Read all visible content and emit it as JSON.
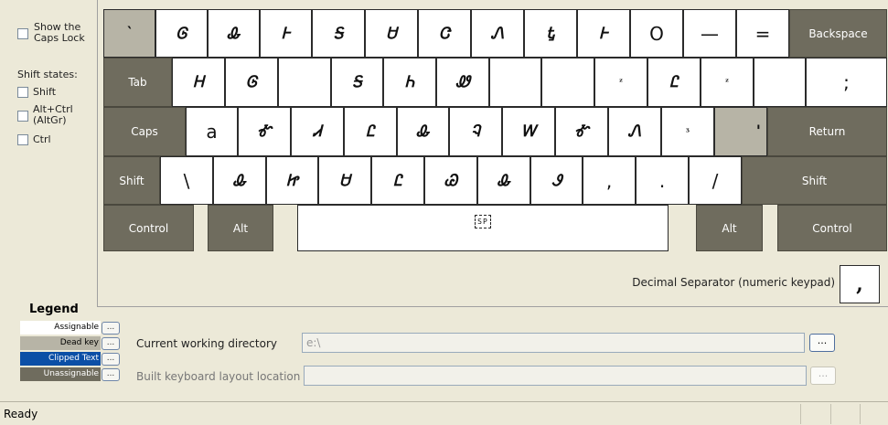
{
  "left_panel": {
    "show_caps_lock": "Show the Caps Lock",
    "show_caps_line1": "Show the",
    "show_caps_line2": "Caps Lock",
    "shift_states_label": "Shift states:",
    "shift": "Shift",
    "altctrl_line1": "Alt+Ctrl",
    "altctrl_line2": "(AltGr)",
    "ctrl": "Ctrl"
  },
  "keys": {
    "row1": [
      "`",
      "Ꮆ",
      "Ꮂ",
      "Ꮀ",
      "Ꭶ",
      "Ꮜ",
      "Ꮳ",
      "Ꮑ",
      "Ꮏ",
      "Ꮀ",
      "O",
      "—",
      "="
    ],
    "backspace": "Backspace",
    "tab": "Tab",
    "row2": [
      "Ꮋ",
      "Ꮆ",
      "",
      "Ꭶ",
      "Ꮒ",
      "Ꮺ",
      "",
      "",
      "ᶻ",
      "Ꮭ",
      "ᶻ",
      "",
      ";"
    ],
    "caps": "Caps",
    "row3": [
      "a",
      "Ꮉ",
      "Ꮧ",
      "Ꮭ",
      "Ꮂ",
      "Ꮈ",
      "Ꮃ",
      "Ꮉ",
      "Ꮑ",
      "ᶾ",
      "'"
    ],
    "return": "Return",
    "shift_left": "Shift",
    "row4": [
      "\\",
      "Ꮂ",
      "Ꮵ",
      "Ꮜ",
      "Ꮭ",
      "Ꮚ",
      "Ꮂ",
      "Ꮽ",
      ",",
      ".",
      "/"
    ],
    "shift_right": "Shift",
    "control_left": "Control",
    "alt_left": "Alt",
    "space": "SP",
    "alt_right": "Alt",
    "control_right": "Control"
  },
  "decimal": {
    "label": "Decimal Separator (numeric keypad)",
    "value": ","
  },
  "legend": {
    "title": "Legend",
    "items": [
      "Assignable",
      "Dead key",
      "Clipped Text",
      "Unassignable"
    ],
    "button": "...",
    "colors": {
      "assignable": "#ffffff",
      "dead_key": "#b7b4a6",
      "clipped_text": "#0b4fa6",
      "unassignable": "#6f6c5e"
    }
  },
  "paths": {
    "cwd_label": "Current working directory",
    "cwd_value": "e:\\",
    "build_label": "Built keyboard layout location",
    "build_value": "",
    "browse": "..."
  },
  "status": {
    "text": "Ready"
  }
}
